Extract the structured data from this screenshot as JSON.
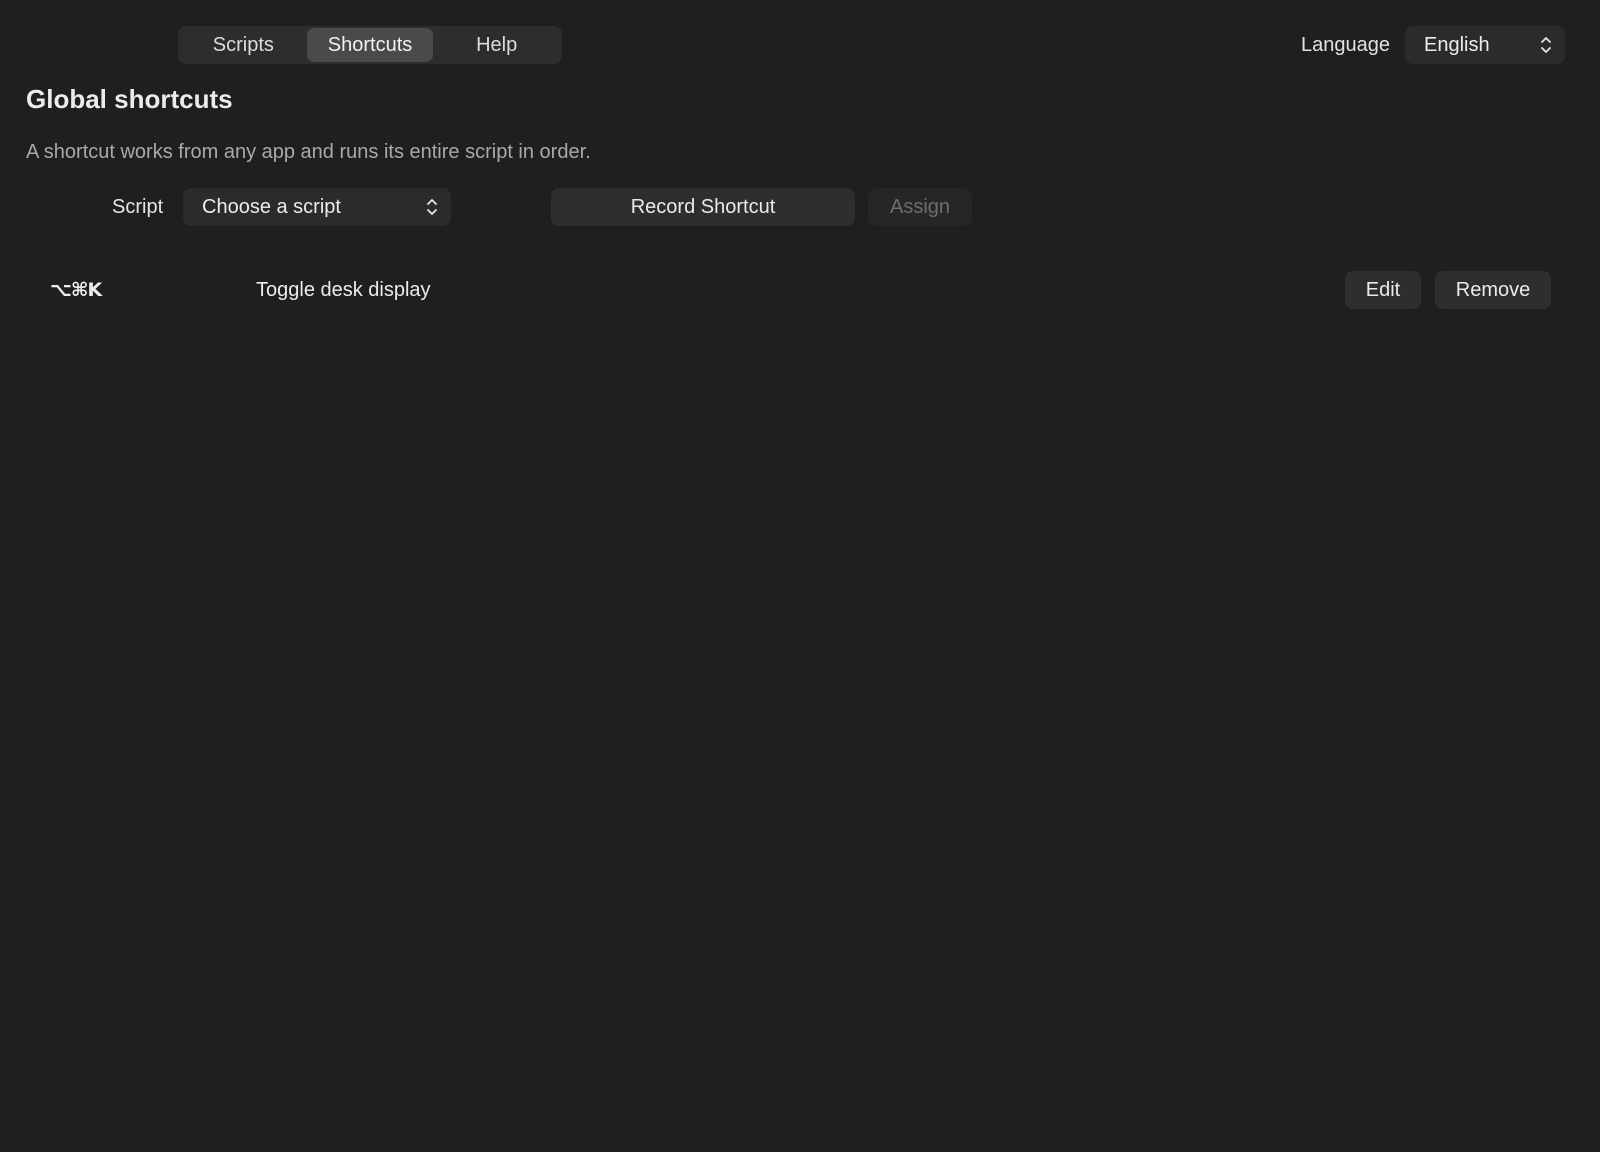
{
  "tabs": [
    {
      "label": "Scripts",
      "active": false
    },
    {
      "label": "Shortcuts",
      "active": true
    },
    {
      "label": "Help",
      "active": false
    }
  ],
  "language": {
    "label": "Language",
    "value": "English"
  },
  "header": {
    "title": "Global shortcuts",
    "description": "A shortcut works from any app and runs its entire script in order."
  },
  "assign_form": {
    "script_label": "Script",
    "script_value": "Choose a script",
    "record_label": "Record Shortcut",
    "assign_label": "Assign"
  },
  "shortcuts": [
    {
      "keys": "⌥⌘K",
      "script": "Toggle desk display",
      "edit_label": "Edit",
      "remove_label": "Remove"
    }
  ],
  "colors": {
    "background": "#1f1f1f",
    "control": "#2e2e2e",
    "active_segment": "#4a4a4a",
    "disabled_text": "#6e6e6e"
  },
  "icons": {
    "select_chevron": "chevron-up-down-icon"
  }
}
